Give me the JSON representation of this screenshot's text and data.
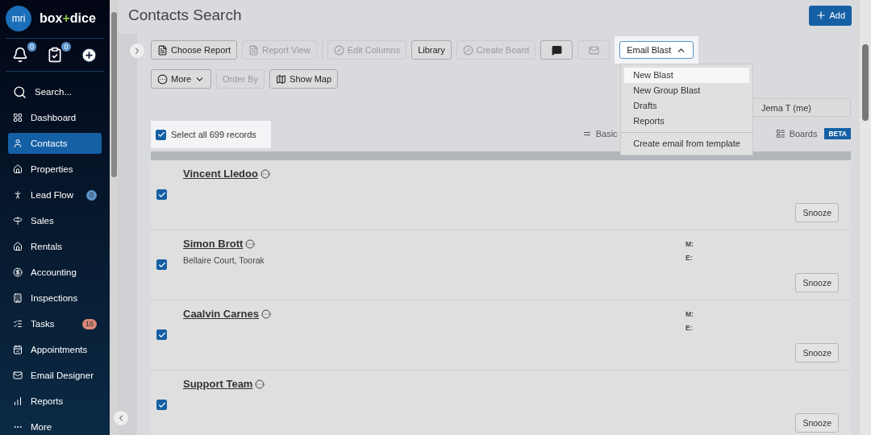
{
  "sidebar": {
    "logo": "mri",
    "brand": [
      {
        "text": "box",
        "kind": "plain"
      },
      {
        "text": "+",
        "kind": "accent"
      },
      {
        "text": "dice",
        "kind": "plain"
      }
    ],
    "quick_actions": {
      "notifications_badge": "0",
      "tasks_badge": "0"
    },
    "items": [
      {
        "label": "Search...",
        "selected": false
      },
      {
        "label": "Dashboard",
        "selected": false
      },
      {
        "label": "Contacts",
        "selected": true
      },
      {
        "label": "Properties",
        "selected": false
      },
      {
        "label": "Lead Flow",
        "selected": false,
        "badge": "0",
        "color": "#5b93c9"
      },
      {
        "label": "Sales",
        "selected": false
      },
      {
        "label": "Rentals",
        "selected": false
      },
      {
        "label": "Accounting",
        "selected": false
      },
      {
        "label": "Inspections",
        "selected": false
      },
      {
        "label": "Tasks",
        "selected": false,
        "badge": "16",
        "color": "#d9877a"
      },
      {
        "label": "Appointments",
        "selected": false
      },
      {
        "label": "Email Designer",
        "selected": false
      },
      {
        "label": "Reports",
        "selected": false
      },
      {
        "label": "More",
        "selected": false
      }
    ]
  },
  "header": {
    "title": "Contacts Search",
    "add_button": "Add"
  },
  "toolbar": {
    "row_1": [
      {
        "kind": "report",
        "label": "Choose Report",
        "disabled": false
      },
      {
        "kind": "report",
        "label": "Report View",
        "disabled": true
      },
      {
        "kind": "divider"
      },
      {
        "kind": "edit",
        "label": "Edit Columns",
        "disabled": true
      },
      {
        "kind": "text",
        "label": "Library",
        "disabled": false
      },
      {
        "kind": "edit",
        "label": "Create Board",
        "disabled": true
      },
      {
        "kind": "chat",
        "disabled": false
      },
      {
        "kind": "mail",
        "disabled": true
      },
      {
        "kind": "dropdown",
        "label": "Email Blast",
        "expanded": true
      }
    ],
    "row_2": [
      {
        "kind": "more",
        "label": "More",
        "disabled": false,
        "expanded": false
      },
      {
        "kind": "text",
        "label": "Order By",
        "disabled": true
      },
      {
        "kind": "map",
        "label": "Show Map",
        "disabled": false
      }
    ]
  },
  "email_blast_menu": {
    "groups": [
      [
        {
          "label": "New Blast",
          "selected": true
        },
        {
          "label": "New Group Blast",
          "selected": false
        },
        {
          "label": "Drafts",
          "selected": false
        },
        {
          "label": "Reports",
          "selected": false
        }
      ],
      [
        {
          "label": "Create email from template",
          "selected": false
        }
      ]
    ]
  },
  "owner_field": {
    "value": "Jema T (me)"
  },
  "select_all": {
    "label": "Select all 699 records",
    "checked": true
  },
  "view_tabs": [
    {
      "label": "Basic",
      "selected": false
    },
    {
      "label": "Boards",
      "selected": false,
      "badge": "BETA"
    }
  ],
  "contacts": [
    {
      "name": "Vincent Lledoo",
      "checked": true,
      "snooze": "Snooze"
    },
    {
      "name": "Simon Brott",
      "address": "Bellaire Court, Toorak",
      "fields": [
        "M:",
        "E:"
      ],
      "checked": true,
      "snooze": "Snooze"
    },
    {
      "name": "Caalvin Carnes",
      "fields": [
        "M:",
        "E:"
      ],
      "checked": true,
      "snooze": "Snooze"
    },
    {
      "name": "Support Team",
      "checked": true,
      "snooze": "Snooze"
    }
  ]
}
